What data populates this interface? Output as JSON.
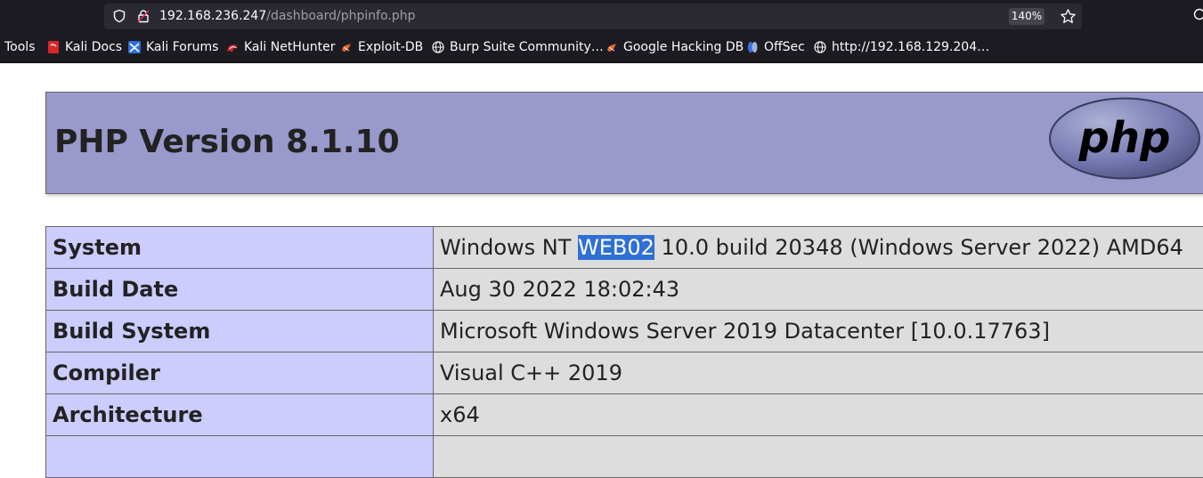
{
  "browser": {
    "url_host": "192.168.236.247",
    "url_path": "/dashboard/phpinfo.php",
    "zoom": "140%",
    "bookmarks": [
      {
        "label": "Tools",
        "icon": "none"
      },
      {
        "label": "Kali Docs",
        "icon": "kali-docs-icon"
      },
      {
        "label": "Kali Forums",
        "icon": "kali-forums-icon"
      },
      {
        "label": "Kali NetHunter",
        "icon": "kali-nethunter-icon"
      },
      {
        "label": "Exploit-DB",
        "icon": "exploit-db-icon"
      },
      {
        "label": "Burp Suite Community…",
        "icon": "globe-icon"
      },
      {
        "label": "Google Hacking DB",
        "icon": "exploit-db-icon"
      },
      {
        "label": "OffSec",
        "icon": "offsec-icon"
      },
      {
        "label": "http://192.168.129.204…",
        "icon": "globe-icon"
      }
    ]
  },
  "page": {
    "title": "PHP Version 8.1.10",
    "logo_text": "php",
    "rows": [
      {
        "label": "System",
        "value_before": "Windows NT ",
        "value_highlight": "WEB02",
        "value_after": " 10.0 build 20348 (Windows Server 2022) AMD64"
      },
      {
        "label": "Build Date",
        "value": "Aug 30 2022 18:02:43"
      },
      {
        "label": "Build System",
        "value": "Microsoft Windows Server 2019 Datacenter [10.0.17763]"
      },
      {
        "label": "Compiler",
        "value": "Visual C++ 2019"
      },
      {
        "label": "Architecture",
        "value": "x64"
      }
    ]
  },
  "colors": {
    "header_bg": "#9999cc",
    "label_bg": "#ccccff",
    "value_bg": "#dddddd",
    "selection": "#2f6fd6"
  }
}
